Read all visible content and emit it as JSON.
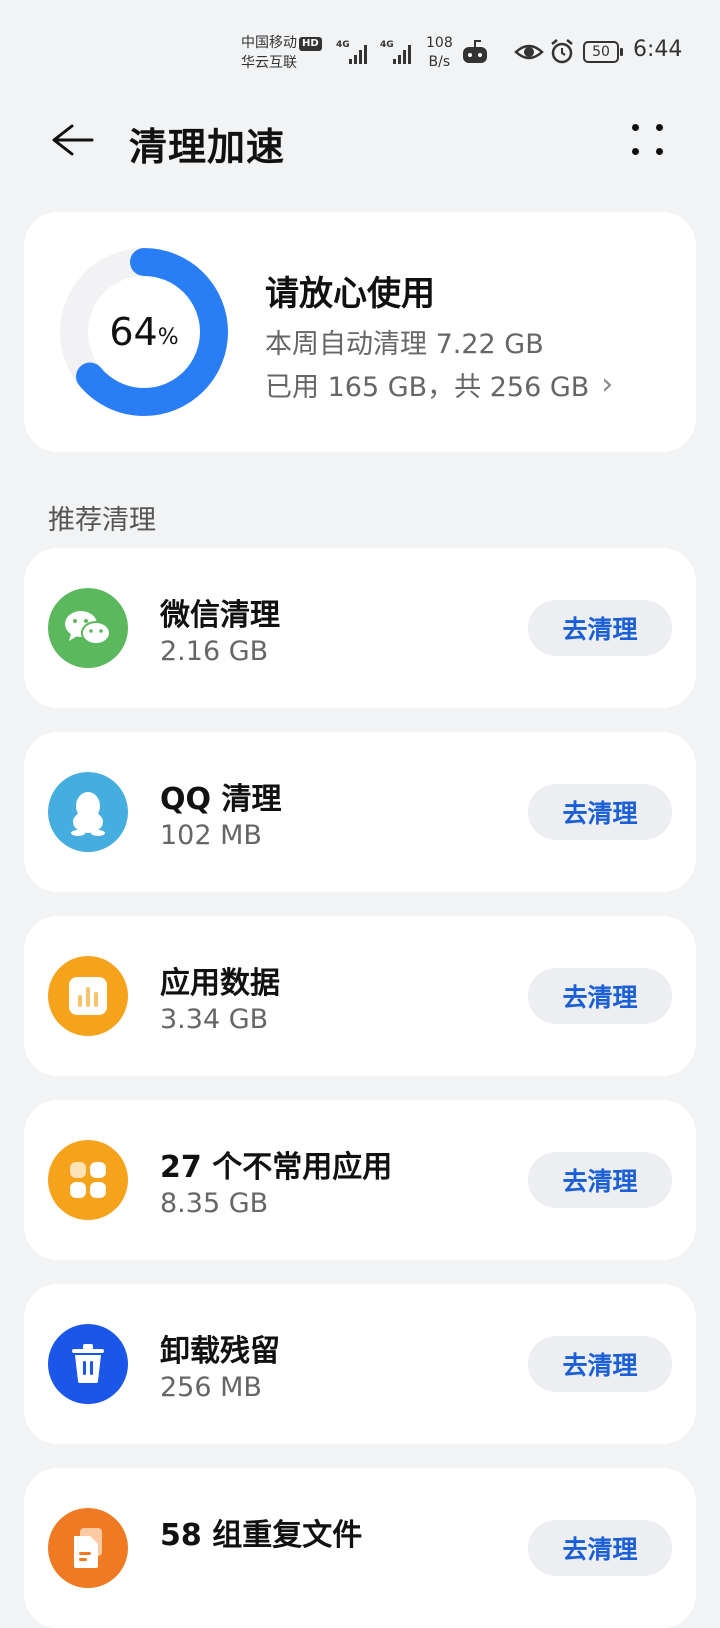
{
  "status_bar": {
    "carrier_line1": "中国移动",
    "hd": "HD",
    "carrier_line2": "华云互联",
    "sig1_label": "4G",
    "sig2_label": "4G",
    "net_speed_value": "108",
    "net_speed_unit": "B/s",
    "battery": "50",
    "time": "6:44"
  },
  "header": {
    "title": "清理加速",
    "back_icon": "back-arrow-icon",
    "more_icon": "more-dots-icon"
  },
  "storage": {
    "percent": "64",
    "percent_unit": "%",
    "used_fraction": 0.64,
    "title": "请放心使用",
    "weekly_cleaned": "本周自动清理 7.22 GB",
    "usage": "已用 165 GB，共 256 GB",
    "ring_color": "#2a7ef5"
  },
  "section": {
    "label": "推荐清理"
  },
  "items": [
    {
      "name": "微信清理",
      "size": "2.16 GB",
      "button": "去清理",
      "icon": "wechat-icon",
      "color": "#5cb85c"
    },
    {
      "name": "QQ 清理",
      "size": "102 MB",
      "button": "去清理",
      "icon": "qq-penguin-icon",
      "color": "#45ade0"
    },
    {
      "name": "应用数据",
      "size": "3.34 GB",
      "button": "去清理",
      "icon": "app-data-chart-icon",
      "color": "#f6a31c"
    },
    {
      "name": "27 个不常用应用",
      "size": "8.35 GB",
      "button": "去清理",
      "icon": "apps-grid-icon",
      "color": "#f6a31c"
    },
    {
      "name": "卸载残留",
      "size": "256 MB",
      "button": "去清理",
      "icon": "trash-icon",
      "color": "#1a56e8"
    },
    {
      "name": "58 组重复文件",
      "size": "",
      "button": "去清理",
      "icon": "duplicate-files-icon",
      "color": "#f07a24"
    }
  ]
}
